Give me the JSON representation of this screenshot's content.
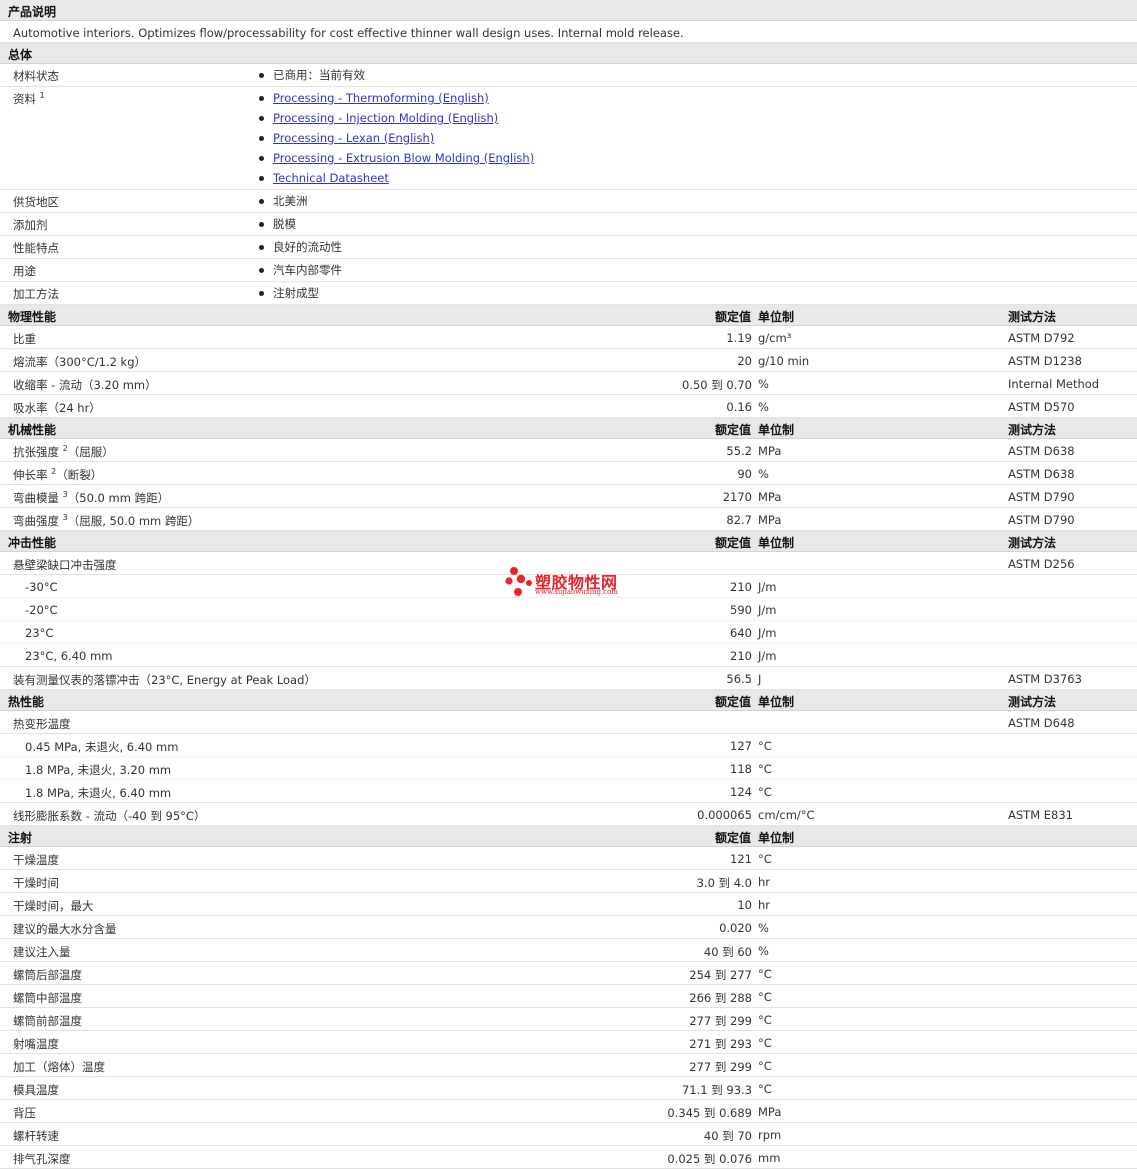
{
  "desc_section": {
    "title": "产品说明",
    "text": "Automotive interiors. Optimizes flow/processability for cost effective thinner wall design uses. Internal mold release."
  },
  "general": {
    "title": "总体",
    "rows": [
      {
        "label": "材料状态",
        "items": [
          "已商用：当前有效"
        ]
      },
      {
        "label": "资料",
        "sup": "1",
        "links": [
          "Processing - Thermoforming (English)",
          "Processing - Injection Molding (English)",
          "Processing - Lexan (English)",
          "Processing - Extrusion Blow Molding (English)",
          "Technical Datasheet"
        ]
      },
      {
        "label": "供货地区",
        "items": [
          "北美洲"
        ]
      },
      {
        "label": "添加剂",
        "items": [
          "脱模"
        ]
      },
      {
        "label": "性能特点",
        "items": [
          "良好的流动性"
        ]
      },
      {
        "label": "用途",
        "items": [
          "汽车内部零件"
        ]
      },
      {
        "label": "加工方法",
        "items": [
          "注射成型"
        ]
      }
    ]
  },
  "col_headers": {
    "value": "额定值",
    "unit": "单位制",
    "method": "测试方法"
  },
  "physical": {
    "title": "物理性能",
    "rows": [
      {
        "name": "比重",
        "value": "1.19",
        "unit": "g/cm³",
        "method": "ASTM D792"
      },
      {
        "name": "熔流率（300°C/1.2 kg）",
        "value": "20",
        "unit": "g/10 min",
        "method": "ASTM D1238"
      },
      {
        "name": "收缩率 - 流动（3.20 mm）",
        "value": "0.50 到  0.70",
        "unit": "%",
        "method": "Internal Method"
      },
      {
        "name": "吸水率（24 hr）",
        "value": "0.16",
        "unit": "%",
        "method": "ASTM D570"
      }
    ]
  },
  "mechanical": {
    "title": "机械性能",
    "rows": [
      {
        "name": "抗张强度",
        "sup": "2",
        "suffix": "（屈服）",
        "value": "55.2",
        "unit": "MPa",
        "method": "ASTM D638"
      },
      {
        "name": "伸长率",
        "sup": "2",
        "suffix": "（断裂）",
        "value": "90",
        "unit": "%",
        "method": "ASTM D638"
      },
      {
        "name": "弯曲模量",
        "sup": "3",
        "suffix": "（50.0 mm 跨距）",
        "value": "2170",
        "unit": "MPa",
        "method": "ASTM D790"
      },
      {
        "name": "弯曲强度",
        "sup": "3",
        "suffix": "（屈服, 50.0 mm 跨距）",
        "value": "82.7",
        "unit": "MPa",
        "method": "ASTM D790"
      }
    ]
  },
  "impact": {
    "title": "冲击性能",
    "rows": [
      {
        "name": "悬壁梁缺口冲击强度",
        "value": "",
        "unit": "",
        "method": "ASTM D256"
      },
      {
        "name": "-30°C",
        "sub": true,
        "value": "210",
        "unit": "J/m",
        "method": ""
      },
      {
        "name": "-20°C",
        "sub": true,
        "value": "590",
        "unit": "J/m",
        "method": ""
      },
      {
        "name": "23°C",
        "sub": true,
        "value": "640",
        "unit": "J/m",
        "method": ""
      },
      {
        "name": "23°C, 6.40 mm",
        "sub": true,
        "value": "210",
        "unit": "J/m",
        "method": ""
      },
      {
        "name": "装有测量仪表的落镖冲击（23°C, Energy at Peak Load）",
        "value": "56.5",
        "unit": "J",
        "method": "ASTM D3763"
      }
    ]
  },
  "thermal": {
    "title": "热性能",
    "rows": [
      {
        "name": "热变形温度",
        "value": "",
        "unit": "",
        "method": "ASTM D648"
      },
      {
        "name": "0.45 MPa, 未退火, 6.40 mm",
        "sub": true,
        "value": "127",
        "unit": "°C",
        "method": ""
      },
      {
        "name": "1.8 MPa, 未退火, 3.20 mm",
        "sub": true,
        "value": "118",
        "unit": "°C",
        "method": ""
      },
      {
        "name": "1.8 MPa, 未退火, 6.40 mm",
        "sub": true,
        "value": "124",
        "unit": "°C",
        "method": ""
      },
      {
        "name": "线形膨胀系数 - 流动（-40 到  95°C）",
        "value": "0.000065",
        "unit": "cm/cm/°C",
        "method": "ASTM E831"
      }
    ]
  },
  "injection": {
    "title": "注射",
    "rows": [
      {
        "name": "干燥温度",
        "value": "121",
        "unit": "°C"
      },
      {
        "name": "干燥时间",
        "value": "3.0 到  4.0",
        "unit": "hr"
      },
      {
        "name": "干燥时间，最大",
        "value": "10",
        "unit": "hr"
      },
      {
        "name": "建议的最大水分含量",
        "value": "0.020",
        "unit": "%"
      },
      {
        "name": "建议注入量",
        "value": "40 到  60",
        "unit": "%"
      },
      {
        "name": "螺筒后部温度",
        "value": "254 到  277",
        "unit": "°C"
      },
      {
        "name": "螺筒中部温度",
        "value": "266 到  288",
        "unit": "°C"
      },
      {
        "name": "螺筒前部温度",
        "value": "277 到  299",
        "unit": "°C"
      },
      {
        "name": "射嘴温度",
        "value": "271 到  293",
        "unit": "°C"
      },
      {
        "name": "加工（熔体）温度",
        "value": "277 到  299",
        "unit": "°C"
      },
      {
        "name": "模具温度",
        "value": "71.1 到  93.3",
        "unit": "°C"
      },
      {
        "name": "背压",
        "value": "0.345 到  0.689",
        "unit": "MPa"
      },
      {
        "name": "螺杆转速",
        "value": "40 到  70",
        "unit": "rpm"
      },
      {
        "name": "排气孔深度",
        "value": "0.025 到  0.076",
        "unit": "mm"
      }
    ]
  },
  "watermark": {
    "title": "塑胶物性网",
    "url": "www.sujiaowuxing.com",
    "color": "#e8242c"
  }
}
